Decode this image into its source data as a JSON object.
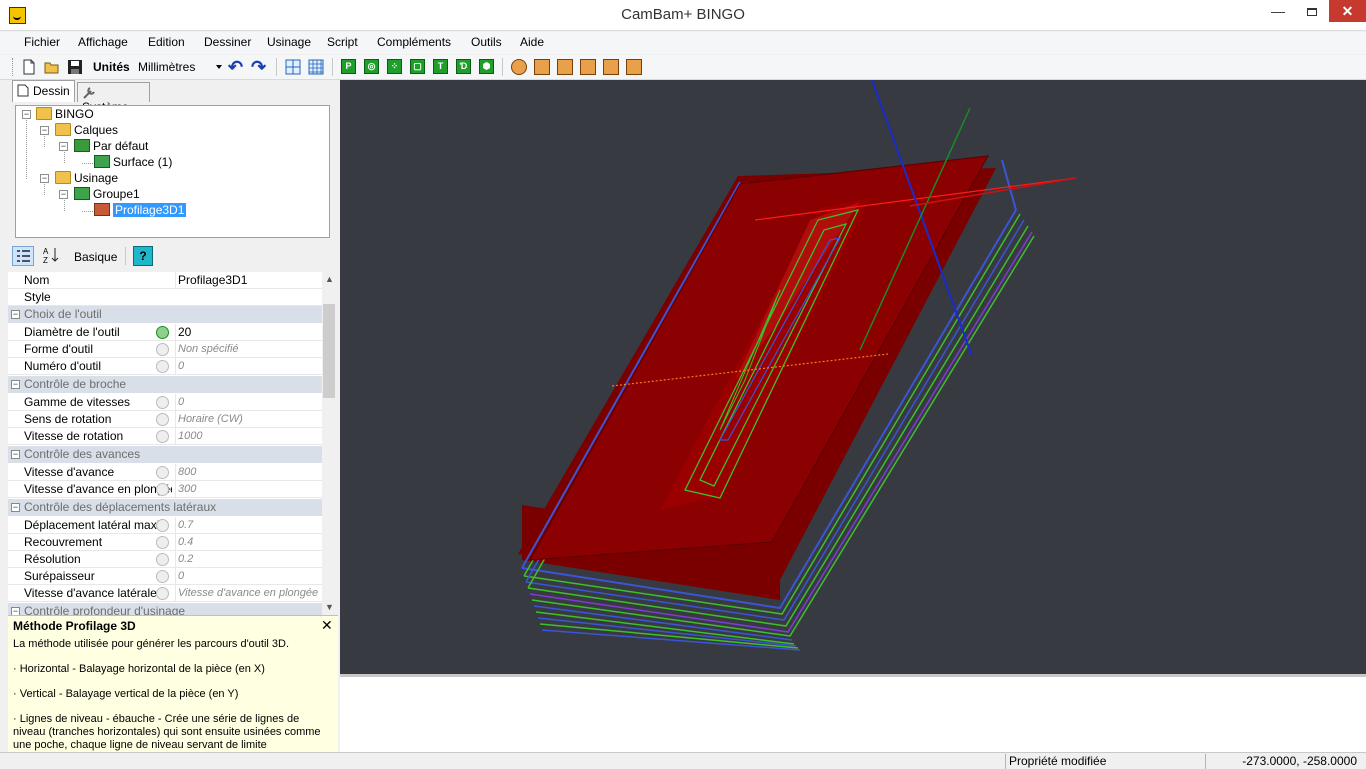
{
  "window": {
    "title": "CamBam+  BINGO",
    "minimize": "—",
    "close": "✕"
  },
  "menu": [
    "Fichier",
    "Affichage",
    "Edition",
    "Dessiner",
    "Usinage",
    "Script",
    "Compléments",
    "Outils",
    "Aide"
  ],
  "toolbar": {
    "units_label": "Unités",
    "units_value": "Millimètres",
    "undo_glyph": "↶",
    "redo_glyph": "↷",
    "op_icons": [
      "P",
      "◎",
      "⁘",
      "▢",
      "T",
      "Ɗ",
      "⬢"
    ]
  },
  "tabs": {
    "dessin": "Dessin",
    "systeme": "Système"
  },
  "tree": {
    "root": "BINGO",
    "layers": "Calques",
    "default_layer": "Par défaut",
    "surface": "Surface (1)",
    "machining": "Usinage",
    "group": "Groupe1",
    "toolpath": "Profilage3D1"
  },
  "prop_toolbar": {
    "basic": "Basique",
    "help": "?"
  },
  "properties": {
    "name_label": "Nom",
    "name_value": "Profilage3D1",
    "style_label": "Style",
    "style_value": "",
    "cat_tool": "Choix de l'outil",
    "tool_diameter_label": "Diamètre de l'outil",
    "tool_diameter_value": "20",
    "tool_shape_label": "Forme d'outil",
    "tool_shape_value": "Non spécifié",
    "tool_number_label": "Numéro d'outil",
    "tool_number_value": "0",
    "cat_spindle": "Contrôle de broche",
    "speed_range_label": "Gamme de vitesses",
    "speed_range_value": "0",
    "rotation_dir_label": "Sens de rotation",
    "rotation_dir_value": "Horaire (CW)",
    "spindle_speed_label": "Vitesse de rotation",
    "spindle_speed_value": "1000",
    "cat_feeds": "Contrôle des avances",
    "feed_label": "Vitesse d'avance",
    "feed_value": "800",
    "plunge_label": "Vitesse d'avance en plongée",
    "plunge_value": "300",
    "cat_lateral": "Contrôle des déplacements latéraux",
    "stepover_label": "Déplacement latéral maxi",
    "stepover_value": "0.7",
    "overlap_label": "Recouvrement",
    "overlap_value": "0.4",
    "resolution_label": "Résolution",
    "resolution_value": "0.2",
    "thickness_label": "Surépaisseur",
    "thickness_value": "0",
    "lateral_feed_label": "Vitesse d'avance latérale",
    "lateral_feed_value": "Vitesse d'avance en plongée",
    "cat_depth": "Contrôle profondeur d'usinage"
  },
  "description": {
    "title": "Méthode Profilage 3D",
    "line1": "La méthode utilisée pour générer les parcours d'outil 3D.",
    "line2": "· Horizontal - Balayage horizontal de la pièce (en X)",
    "line3": "· Vertical - Balayage vertical de la pièce (en Y)",
    "line4": "· Lignes de niveau - ébauche - Crée une série de lignes de niveau (tranches horizontales) qui sont ensuite usinées comme une poche, chaque ligne de niveau servant de limite"
  },
  "status": {
    "message": "Propriété modifiée",
    "coordinates": "-273.0000, -258.0000"
  },
  "colors": {
    "viewport_bg": "#373a41",
    "stock_red": "#8b0000",
    "toolpath_green": "#3fbf2a",
    "toolpath_blue": "#3b55d6",
    "selection_blue": "#3399ff"
  }
}
